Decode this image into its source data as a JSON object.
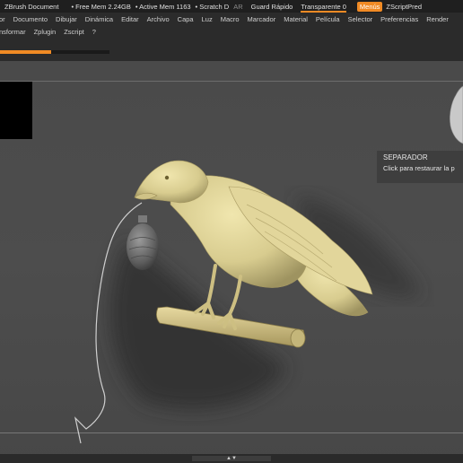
{
  "titlebar": {
    "app_title": "ZBrush Document",
    "free_mem": "• Free Mem 2.24GB",
    "active_mem": "• Active Mem 1163",
    "scratch": "• Scratch D",
    "ar": "AR",
    "quick_save": "Guard Rápido",
    "transparency": "Transparente 0",
    "menus": "Menús",
    "script": "ZScriptPred"
  },
  "menu": {
    "row1": [
      "or",
      "Documento",
      "Dibujar",
      "Dinámica",
      "Editar",
      "Archivo",
      "Capa",
      "Luz",
      "Macro",
      "Marcador",
      "Material",
      "Película",
      "Selector",
      "Preferencias",
      "Render"
    ],
    "row2": [
      "nsformar",
      "Zplugin",
      "Zscript",
      "?"
    ]
  },
  "progress": {
    "fraction": 0.47
  },
  "tooltip": {
    "title": "SEPARADOR",
    "body": "Click para restaurar la p"
  },
  "colors": {
    "accent": "#f08a24",
    "model": "#d8cc8f",
    "background": "#4a4a4a"
  },
  "icons": {
    "bottom_handle": "chevron-up-down-icon"
  }
}
